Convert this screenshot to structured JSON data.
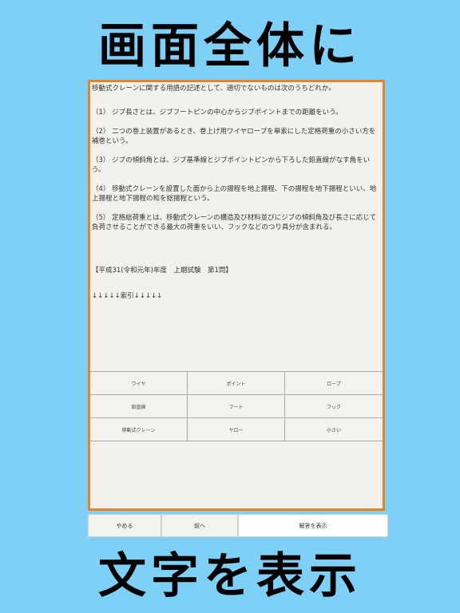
{
  "banner": {
    "top": "画面全体に",
    "bottom": "文字を表示"
  },
  "question": {
    "title": "移動式クレーンに関する用語の記述として、適切でないものは次のうちどれか。",
    "options": [
      "（1） ジブ長さとは、ジブフートピンの中心からジブポイントまでの距離をいう。",
      "（2） 二つの巻上装置があるとき、巻上げ用ワイヤロープを単索にした定格荷重の小さい方を補巻という。",
      "（3） ジブの傾斜角とは、ジブ基準線とジブポイントピンから下ろした鉛直線がなす角をいう。",
      "（4） 移動式クレーンを設置した面から上の揚程を地上揚程、下の揚程を地下揚程といい、地上揚程と地下揚程の和を総揚程という。",
      "（5） 定格総荷重とは、移動式クレーンの構造及び材料並びにジブの傾斜角及び長さに応じて負荷させることができる最大の荷重をいい、フックなどのつり具分が含まれる。"
    ],
    "source": "【平成31(令和元年)年度　上期試験　第1問】",
    "index_label": "↓↓↓↓↓索引↓↓↓↓↓"
  },
  "keywords": [
    "ワイヤ",
    "ポイント",
    "ロープ",
    "鉛直線",
    "フート",
    "フック",
    "移動式クレーン",
    "ヤロー",
    "小さい"
  ],
  "actions": {
    "quit": "やめる",
    "prev": "前へ",
    "show_answer": "解答を表示"
  }
}
